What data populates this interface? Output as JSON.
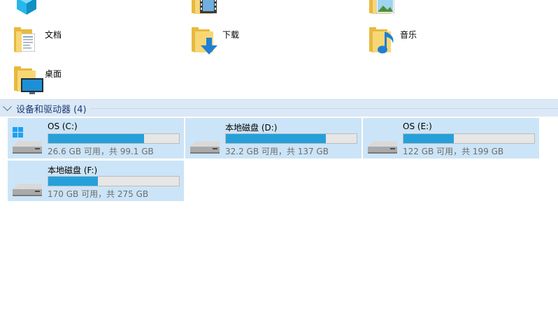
{
  "folders": [
    {
      "name": ""
    },
    {
      "name": ""
    },
    {
      "name": ""
    },
    {
      "name": "文档"
    },
    {
      "name": "下载"
    },
    {
      "name": "音乐"
    },
    {
      "name": "桌面"
    }
  ],
  "section": {
    "title": "设备和驱动器 (4)"
  },
  "drives": [
    {
      "name": "OS (C:)",
      "free_text": "26.6 GB 可用，共 99.1 GB",
      "used_fraction": 0.73
    },
    {
      "name": "本地磁盘 (D:)",
      "free_text": "32.2 GB 可用，共 137 GB",
      "used_fraction": 0.765
    },
    {
      "name": "OS (E:)",
      "free_text": "122 GB 可用，共 199 GB",
      "used_fraction": 0.387
    },
    {
      "name": "本地磁盘 (F:)",
      "free_text": "170 GB 可用，共 275 GB",
      "used_fraction": 0.382
    }
  ],
  "colors": {
    "usage_bar": "#26a0da",
    "tile_selected": "#cce4f7",
    "section_title": "#1e3a78"
  }
}
